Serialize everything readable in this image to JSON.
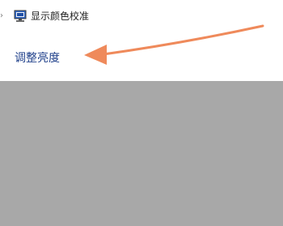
{
  "window": {
    "links": {
      "display_calibration": "显示颜色校准",
      "adjust_brightness": "调整亮度"
    }
  },
  "icons": {
    "display_calibration": "monitor-icon",
    "annotation": "arrow-icon"
  },
  "colors": {
    "link": "#1e3f8a",
    "arrow": "#ef8a5b",
    "bottom_background": "#a8a8a8"
  }
}
